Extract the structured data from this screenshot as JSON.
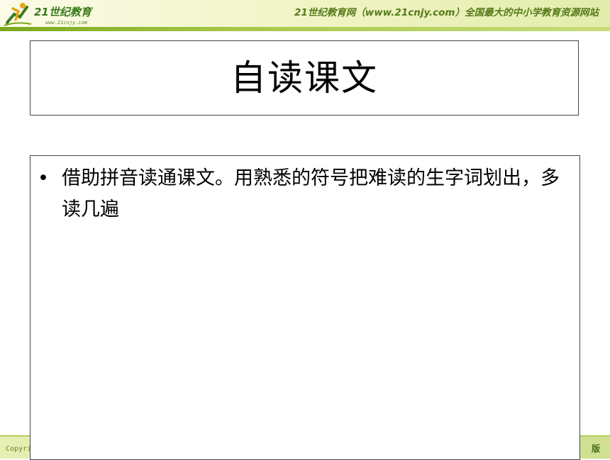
{
  "header": {
    "logo_brand": "21世纪教育",
    "logo_url": "www.21cnjy.com",
    "site_title": "21世纪教育网（www.21cnjy.com）全国最大的中小学教育资源网站"
  },
  "slide": {
    "title": "自读课文",
    "bullets": [
      {
        "marker": "•",
        "text": "借助拼音读通课文。用熟悉的符号把难读的生字词划出，多读几遍"
      }
    ]
  },
  "footer": {
    "left_text": "Copyri",
    "right_text": "版"
  },
  "colors": {
    "header_bg": "#f2f5c8",
    "header_stripe": "#7aa81c",
    "brand_green": "#3a7a1a"
  },
  "icons": {
    "logo": "running-figure-logo-icon"
  }
}
